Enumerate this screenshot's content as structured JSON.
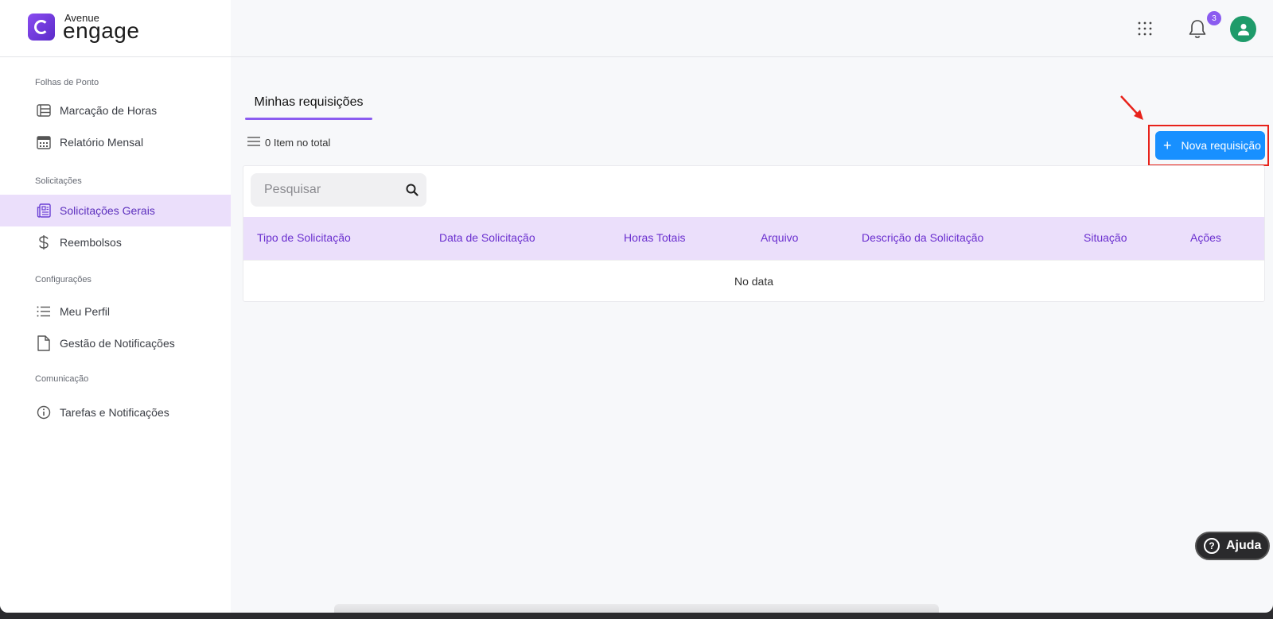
{
  "brand": {
    "top": "Avenue",
    "main": "engage"
  },
  "sidebar": {
    "sections": [
      {
        "label": "Folhas de Ponto",
        "items": [
          {
            "label": "Marcação de Horas",
            "icon": "list-view-icon"
          },
          {
            "label": "Relatório Mensal",
            "icon": "calendar-icon"
          }
        ]
      },
      {
        "label": "Solicitações",
        "items": [
          {
            "label": "Solicitações Gerais",
            "icon": "form-document-icon",
            "active": true
          },
          {
            "label": "Reembolsos",
            "icon": "dollar-icon"
          }
        ]
      },
      {
        "label": "Configurações",
        "items": [
          {
            "label": "Meu Perfil",
            "icon": "list-icon"
          },
          {
            "label": "Gestão de Notificações",
            "icon": "file-icon"
          }
        ]
      },
      {
        "label": "Comunicação",
        "items": [
          {
            "label": "Tarefas e Notificações",
            "icon": "info-icon"
          }
        ]
      }
    ]
  },
  "topbar": {
    "notification_count": "3"
  },
  "main": {
    "tab_label": "Minhas requisições",
    "item_count_text": "0 Item no total",
    "new_button_label": "Nova requisição",
    "search_placeholder": "Pesquisar",
    "table": {
      "columns": [
        "Tipo de Solicitação",
        "Data de Solicitação",
        "Horas Totais",
        "Arquivo",
        "Descrição da Solicitação",
        "Situação",
        "Ações"
      ],
      "empty_text": "No data"
    }
  },
  "help_button_label": "Ajuda",
  "colors": {
    "accent": "#8b5cf0",
    "primary_button": "#1890ff",
    "active_bg": "#ebdffb",
    "highlight": "#e8221a"
  }
}
